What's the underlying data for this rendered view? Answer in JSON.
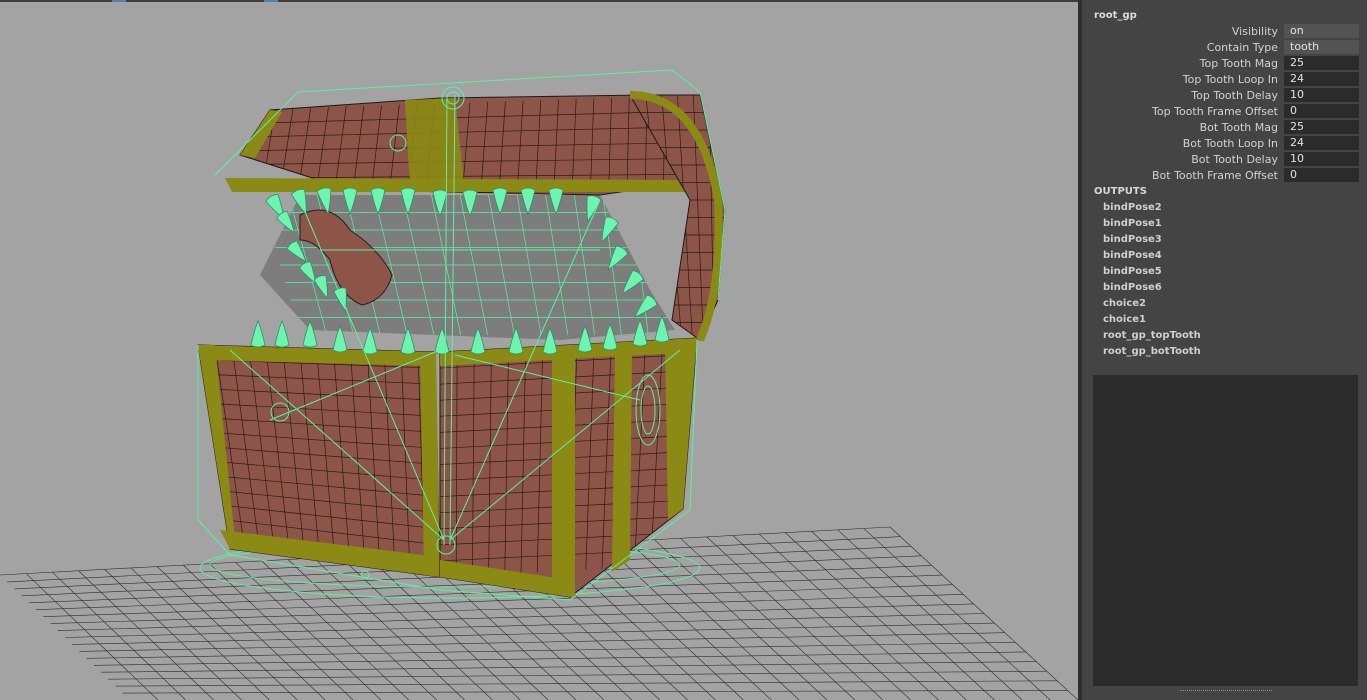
{
  "panel": {
    "node_name": "root_gp",
    "attributes": [
      {
        "label": "Visibility",
        "value": "on",
        "kind": "enum"
      },
      {
        "label": "Contain Type",
        "value": "tooth",
        "kind": "enum"
      },
      {
        "label": "Top Tooth Mag",
        "value": "25",
        "kind": "number"
      },
      {
        "label": "Top Tooth Loop In",
        "value": "24",
        "kind": "number"
      },
      {
        "label": "Top Tooth Delay",
        "value": "10",
        "kind": "number"
      },
      {
        "label": "Top Tooth Frame Offset",
        "value": "0",
        "kind": "number"
      },
      {
        "label": "Bot Tooth Mag",
        "value": "25",
        "kind": "number"
      },
      {
        "label": "Bot Tooth Loop In",
        "value": "24",
        "kind": "number"
      },
      {
        "label": "Bot Tooth Delay",
        "value": "10",
        "kind": "number"
      },
      {
        "label": "Bot Tooth Frame Offset",
        "value": "0",
        "kind": "number"
      }
    ],
    "outputs_title": "OUTPUTS",
    "outputs": [
      "bindPose2",
      "bindPose1",
      "bindPose3",
      "bindPose4",
      "bindPose5",
      "bindPose6",
      "choice2",
      "choice1",
      "root_gp_topTooth",
      "root_gp_botTooth"
    ]
  },
  "viewport": {
    "colors": {
      "background": "#a3a3a3",
      "wireframe": "#5ef0a0",
      "wood": "#8c5548",
      "trim": "#8a8a14",
      "grid": "#2d2d2d"
    }
  }
}
